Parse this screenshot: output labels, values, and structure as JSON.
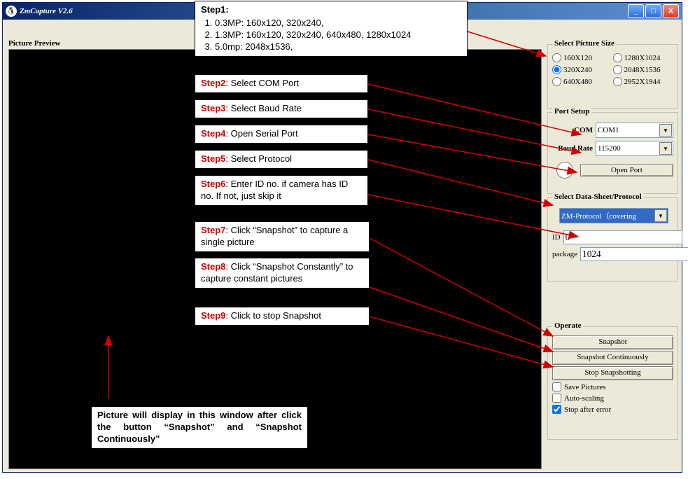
{
  "window": {
    "title": "ZmCapture V2.6",
    "buttons": {
      "min": "_",
      "max": "□",
      "close": "X"
    }
  },
  "preview_label": "Picture Preview",
  "picture_size": {
    "legend": "Select Picture Size",
    "options": [
      {
        "label": "160X120",
        "checked": false
      },
      {
        "label": "1280X1024",
        "checked": false
      },
      {
        "label": "320X240",
        "checked": true
      },
      {
        "label": "2048X1536",
        "checked": false
      },
      {
        "label": "640X480",
        "checked": false
      },
      {
        "label": "2952X1944",
        "checked": false
      }
    ]
  },
  "port_setup": {
    "legend": "Port Setup",
    "com_label": "COM",
    "com_value": "COM1",
    "baud_label": "Baud Rate",
    "baud_value": "115200",
    "open_btn": "Open Port"
  },
  "protocol": {
    "legend": "Select Data-Sheet/Protocol",
    "value": "ZM-Protocol（covering",
    "id_label": "ID",
    "id_value": "0",
    "package_label": "package",
    "package_value": "1024"
  },
  "operate": {
    "legend": "Operate",
    "snapshot": "Snapshot",
    "snapshot_cont": "Snapshot Continuously",
    "stop": "Stop Snapshotting",
    "save": "Save Pictures",
    "auto": "Auto-scaling",
    "stop_err": "Stop after error",
    "save_checked": false,
    "auto_checked": false,
    "stop_err_checked": true
  },
  "annotations": {
    "step1_title": "Step1:",
    "step1_items": [
      "0.3MP: 160x120, 320x240,",
      "1.3MP: 160x120, 320x240, 640x480, 1280x1024",
      "5.0mp: 2048x1536,"
    ],
    "step2_label": "Step2",
    "step2_text": ": Select COM Port",
    "step3_label": "Step3",
    "step3_text": ": Select Baud Rate",
    "step4_label": "Step4",
    "step4_text": ": Open Serial Port",
    "step5_label": "Step5",
    "step5_text": ": Select Protocol",
    "step6_label": "Step6",
    "step6_text": ": Enter ID no. if camera has ID no.  If not, just skip it",
    "step7_label": "Step7",
    "step7_text": ": Click “Snapshot” to capture a single picture",
    "step8_label": "Step8",
    "step8_text": ": Click “Snapshot Constantly” to capture constant pictures",
    "step9_label": "Step9",
    "step9_text": ": Click to stop Snapshot",
    "preview_note": "Picture will display in this window after click the button “Snapshot” and “Snapshot Continuously”"
  }
}
